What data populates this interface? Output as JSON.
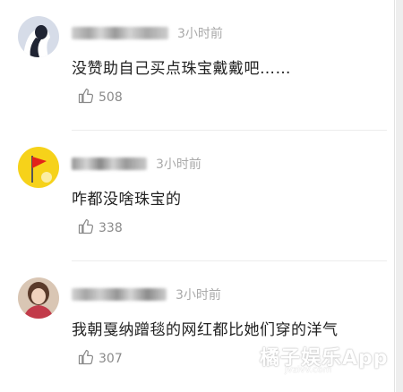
{
  "comments": [
    {
      "time": "3小时前",
      "text": "没赞助自己买点珠宝戴戴吧……",
      "likes": "508"
    },
    {
      "time": "3小时前",
      "text": "咋都没啥珠宝的",
      "likes": "338"
    },
    {
      "time": "3小时前",
      "text": "我朝戛纳蹭毯的网红都比她们穿的洋气",
      "likes": "307"
    }
  ],
  "watermark": {
    "brand": "橘子娱乐App",
    "url": "jvzivv.com"
  },
  "colors": {
    "time": "#a9a9a9",
    "text": "#222222",
    "likes": "#8a8a8a"
  }
}
